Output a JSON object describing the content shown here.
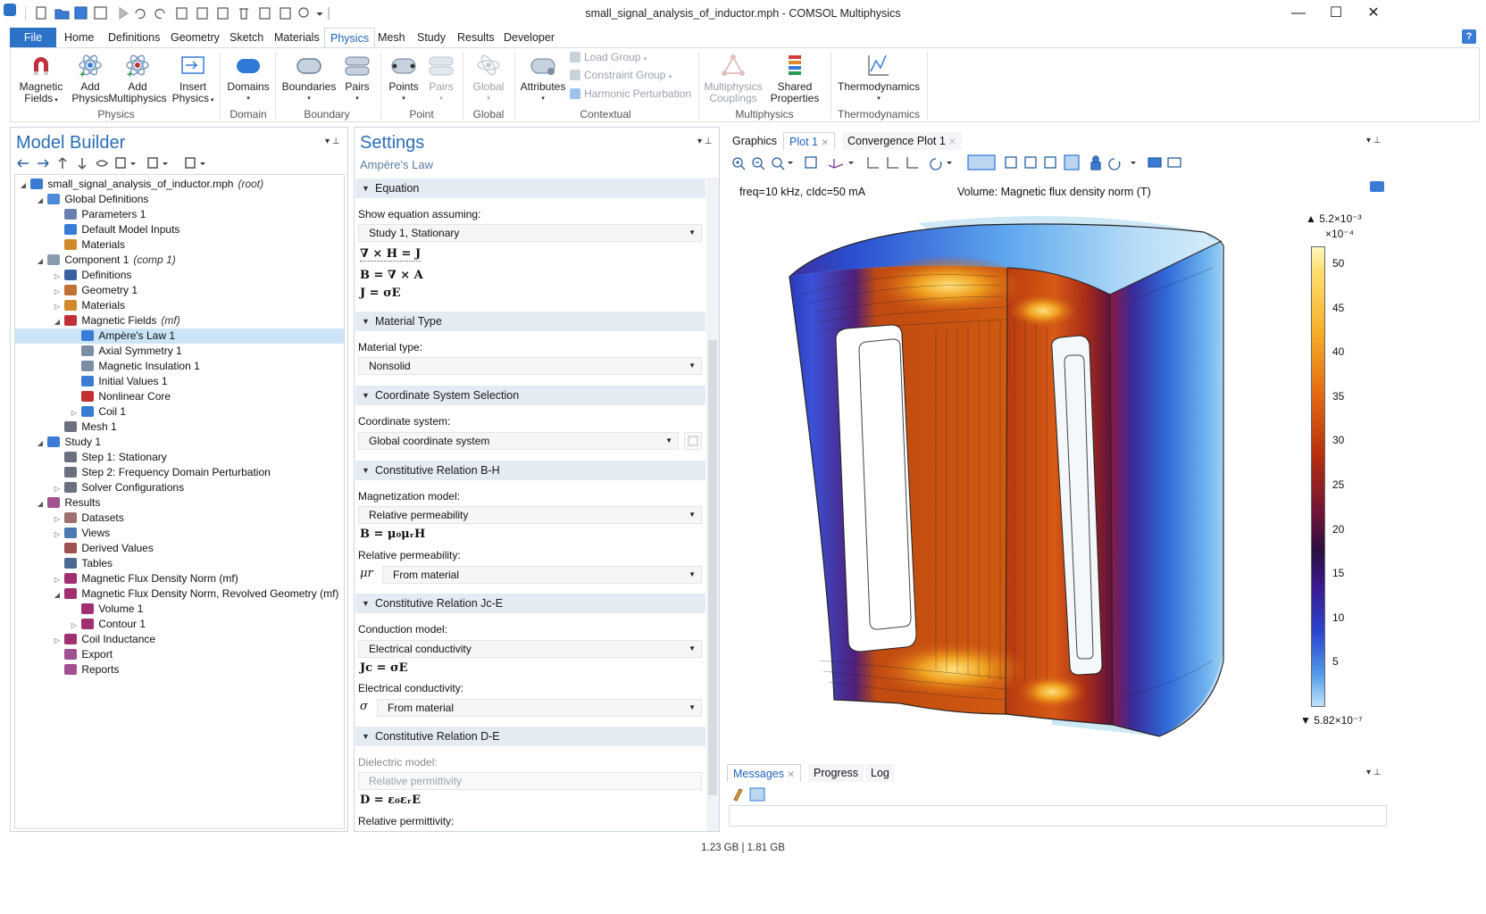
{
  "window": {
    "title": "small_signal_analysis_of_inductor.mph - COMSOL Multiphysics",
    "minimize": "—",
    "maximize": "☐",
    "close": "✕"
  },
  "menu": {
    "tabs": [
      "File",
      "Home",
      "Definitions",
      "Geometry",
      "Sketch",
      "Materials",
      "Physics",
      "Mesh",
      "Study",
      "Results",
      "Developer"
    ],
    "active": "Physics",
    "help": "?"
  },
  "ribbon": {
    "buttons": {
      "magnetic_fields": "Magnetic\nFields",
      "add_physics": "Add\nPhysics",
      "add_multiphysics": "Add\nMultiphysics",
      "insert_physics": "Insert\nPhysics",
      "domains": "Domains",
      "boundaries": "Boundaries",
      "pairs_boundary": "Pairs",
      "points": "Points",
      "pairs_point": "Pairs",
      "global": "Global",
      "attributes": "Attributes",
      "multiphysics_couplings": "Multiphysics\nCouplings",
      "shared_properties": "Shared\nProperties",
      "thermodynamics": "Thermodynamics"
    },
    "small": {
      "load_group": "Load Group",
      "constraint_group": "Constraint Group",
      "harmonic_perturbation": "Harmonic Perturbation"
    },
    "groups": {
      "physics": "Physics",
      "domain": "Domain",
      "boundary": "Boundary",
      "point": "Point",
      "global": "Global",
      "contextual": "Contextual",
      "multiphysics": "Multiphysics",
      "thermodynamics": "Thermodynamics"
    }
  },
  "model_builder": {
    "title": "Model Builder",
    "tree": [
      {
        "label": "small_signal_analysis_of_inductor.mph",
        "suffix": "(root)",
        "icon": "model-root-icon",
        "color": "#3a7bd5",
        "expanded": true
      },
      {
        "label": "Global Definitions",
        "suffix": "",
        "icon": "globe-icon",
        "color": "#4a8ad8",
        "expanded": true
      },
      {
        "label": "Parameters 1",
        "suffix": "",
        "icon": "parameters-icon",
        "color": "#6a7fb0"
      },
      {
        "label": "Default Model Inputs",
        "suffix": "",
        "icon": "model-inputs-icon",
        "color": "#3a7bd5"
      },
      {
        "label": "Materials",
        "suffix": "",
        "icon": "materials-icon",
        "color": "#d08a2a"
      },
      {
        "label": "Component 1",
        "suffix": "(comp 1)",
        "icon": "component-icon",
        "color": "#8a9bb0",
        "expanded": true
      },
      {
        "label": "Definitions",
        "suffix": "",
        "icon": "definitions-icon",
        "color": "#3a5fa0",
        "collapsed": true
      },
      {
        "label": "Geometry 1",
        "suffix": "",
        "icon": "geometry-icon",
        "color": "#c07030",
        "collapsed": true
      },
      {
        "label": "Materials",
        "suffix": "",
        "icon": "materials-icon",
        "color": "#d08a2a",
        "collapsed": true
      },
      {
        "label": "Magnetic Fields",
        "suffix": "(mf)",
        "icon": "magnet-icon",
        "color": "#c0303a",
        "expanded": true
      },
      {
        "label": "Ampère's Law 1",
        "suffix": "",
        "icon": "domain-node-icon",
        "color": "#3a7bd5",
        "selected": true
      },
      {
        "label": "Axial Symmetry 1",
        "suffix": "",
        "icon": "boundary-node-icon",
        "color": "#7a8ea6"
      },
      {
        "label": "Magnetic Insulation 1",
        "suffix": "",
        "icon": "boundary-node-icon",
        "color": "#7a8ea6"
      },
      {
        "label": "Initial Values 1",
        "suffix": "",
        "icon": "initial-values-icon",
        "color": "#3a7bd5"
      },
      {
        "label": "Nonlinear Core",
        "suffix": "",
        "icon": "domain-node-icon",
        "color": "#c03030"
      },
      {
        "label": "Coil 1",
        "suffix": "",
        "icon": "coil-icon",
        "color": "#3a7bd5",
        "collapsed": true
      },
      {
        "label": "Mesh 1",
        "suffix": "",
        "icon": "mesh-icon",
        "color": "#6a7080"
      },
      {
        "label": "Study 1",
        "suffix": "",
        "icon": "study-icon",
        "color": "#3a7bd5",
        "expanded": true
      },
      {
        "label": "Step 1: Stationary",
        "suffix": "",
        "icon": "step-icon",
        "color": "#6a7080"
      },
      {
        "label": "Step 2: Frequency Domain Perturbation",
        "suffix": "",
        "icon": "step-icon",
        "color": "#6a7080"
      },
      {
        "label": "Solver Configurations",
        "suffix": "",
        "icon": "solver-icon",
        "color": "#6a7080",
        "collapsed": true
      },
      {
        "label": "Results",
        "suffix": "",
        "icon": "results-icon",
        "color": "#a05090",
        "expanded": true
      },
      {
        "label": "Datasets",
        "suffix": "",
        "icon": "datasets-icon",
        "color": "#a07070",
        "collapsed": true
      },
      {
        "label": "Views",
        "suffix": "",
        "icon": "views-icon",
        "color": "#4a7ab0",
        "collapsed": true
      },
      {
        "label": "Derived Values",
        "suffix": "",
        "icon": "derived-values-icon",
        "color": "#a05050"
      },
      {
        "label": "Tables",
        "suffix": "",
        "icon": "tables-icon",
        "color": "#4a6a90"
      },
      {
        "label": "Magnetic Flux Density Norm (mf)",
        "suffix": "",
        "icon": "plot-group-icon",
        "color": "#a03070",
        "collapsed": true
      },
      {
        "label": "Magnetic Flux Density Norm, Revolved Geometry (mf)",
        "suffix": "",
        "icon": "plot-group-icon",
        "color": "#a03070",
        "expanded": true
      },
      {
        "label": "Volume 1",
        "suffix": "",
        "icon": "volume-plot-icon",
        "color": "#a03070"
      },
      {
        "label": "Contour 1",
        "suffix": "",
        "icon": "contour-plot-icon",
        "color": "#a03070",
        "collapsed": true
      },
      {
        "label": "Coil Inductance",
        "suffix": "",
        "icon": "plot-1d-icon",
        "color": "#a03070",
        "collapsed": true
      },
      {
        "label": "Export",
        "suffix": "",
        "icon": "export-icon",
        "color": "#a05090"
      },
      {
        "label": "Reports",
        "suffix": "",
        "icon": "reports-icon",
        "color": "#a05090"
      }
    ]
  },
  "settings": {
    "title": "Settings",
    "subtitle": "Ampère's Law",
    "sections": {
      "equation": "Equation",
      "material_type": "Material Type",
      "coordinate_system": "Coordinate System Selection",
      "bh": "Constitutive Relation B-H",
      "jce": "Constitutive Relation Jc-E",
      "de": "Constitutive Relation D-E"
    },
    "show_equation_label": "Show equation assuming:",
    "show_equation_value": "Study 1, Stationary",
    "material_type_label": "Material type:",
    "material_type_value": "Nonsolid",
    "coordinate_system_label": "Coordinate system:",
    "coordinate_system_value": "Global coordinate system",
    "magnetization_label": "Magnetization model:",
    "magnetization_value": "Relative permeability",
    "rel_perm_label": "Relative permeability:",
    "rel_perm_symbol": "μr",
    "rel_perm_value": "From material",
    "conduction_label": "Conduction model:",
    "conduction_value": "Electrical conductivity",
    "conductivity_label": "Electrical conductivity:",
    "conductivity_symbol": "σ",
    "conductivity_value": "From material",
    "dielectric_label": "Dielectric model:",
    "dielectric_value": "Relative permittivity",
    "rel_permittivity_label": "Relative permittivity:",
    "equations": {
      "curl_h": "∇ × H = J",
      "b_curl_a": "B = ∇ × A",
      "j_sigma_e": "J = σE",
      "b_mu_h": "B = μ₀μᵣH",
      "jc_sigma_e": "Jc = σE",
      "d_eps_e": "D = ε₀εᵣE"
    }
  },
  "graphics": {
    "tabs": [
      "Graphics",
      "Plot 1",
      "Convergence Plot 1"
    ],
    "active_tab": "Plot 1",
    "info_left": "freq=10 kHz, cIdc=50 mA",
    "info_right": "Volume: Magnetic flux density norm (T)",
    "colorbar": {
      "max_label": "▲ 5.2×10⁻³",
      "scale": "×10⁻⁴",
      "ticks": [
        "50",
        "45",
        "40",
        "35",
        "30",
        "25",
        "20",
        "15",
        "10",
        "5"
      ],
      "min_label": "▼ 5.82×10⁻⁷"
    }
  },
  "messages": {
    "tabs": [
      "Messages",
      "Progress",
      "Log"
    ],
    "active_tab": "Messages"
  },
  "status": {
    "memory": "1.23 GB | 1.81 GB"
  },
  "colors": {
    "accent": "#2c72c7",
    "selection": "#cce4f7",
    "section_bg": "#e4ebf3"
  }
}
